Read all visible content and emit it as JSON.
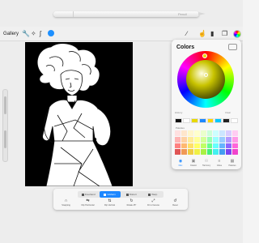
{
  "pencil": {
    "brand": "Pencil"
  },
  "toolbar": {
    "gallery_label": "Gallery",
    "settings_icon": "wrench-icon",
    "adjust_icon": "magic-wand-icon",
    "select_icon": "s-ribbon-icon",
    "move_icon": "arrow-cursor-icon",
    "right_icons": [
      "brush-icon",
      "smudge-icon",
      "eraser-icon",
      "layers-icon",
      "color-icon"
    ]
  },
  "colors_panel": {
    "title": "Colors",
    "mini_labels": [
      "History",
      "Clear",
      "Palettes"
    ],
    "history": [
      "#111111",
      "#ffffff",
      "#e8d800",
      "#1e88ff",
      "#ffd400",
      "#00c8ff",
      "#222222",
      "#ffffff"
    ],
    "palette_label": "Palettes",
    "palette": [
      "#ffe0e0",
      "#ffe6cc",
      "#fff6cc",
      "#ffffcc",
      "#eaffcc",
      "#ccffd9",
      "#ccffff",
      "#cce6ff",
      "#d9ccff",
      "#ffccf2",
      "#ffb3b3",
      "#ffd1a3",
      "#ffeb99",
      "#ffff99",
      "#d4ff99",
      "#99ffb3",
      "#99ffff",
      "#99ccff",
      "#b399ff",
      "#ff99e6",
      "#ff8080",
      "#ffb870",
      "#ffe066",
      "#ffff66",
      "#bfff66",
      "#66ff8c",
      "#66ffff",
      "#66b3ff",
      "#8c66ff",
      "#ff66d9",
      "#e05555",
      "#f09955",
      "#f0cc44",
      "#f0f044",
      "#aaf044",
      "#44f07a",
      "#44f0f0",
      "#449df0",
      "#7a44f0",
      "#f044cc"
    ],
    "tabs": [
      {
        "label": "Disc",
        "icon": "disc-icon",
        "active": true
      },
      {
        "label": "Classic",
        "icon": "square-icon",
        "active": false
      },
      {
        "label": "Harmony",
        "icon": "harmony-icon",
        "active": false
      },
      {
        "label": "Value",
        "icon": "sliders-icon",
        "active": false
      },
      {
        "label": "Palettes",
        "icon": "grid-icon",
        "active": false
      }
    ]
  },
  "bottom_toolbox": {
    "segments": [
      "Freehand",
      "Uniform",
      "Distort",
      "Warp"
    ],
    "active_segment": "Uniform",
    "actions": [
      {
        "label": "Snapping",
        "icon": "magnet-icon"
      },
      {
        "label": "Flip Horizontal",
        "icon": "flip-h-icon"
      },
      {
        "label": "Flip Vertical",
        "icon": "flip-v-icon"
      },
      {
        "label": "Rotate 45°",
        "icon": "rotate-icon"
      },
      {
        "label": "Fit to Canvas",
        "icon": "fit-icon"
      },
      {
        "label": "Reset",
        "icon": "reset-icon"
      }
    ]
  }
}
